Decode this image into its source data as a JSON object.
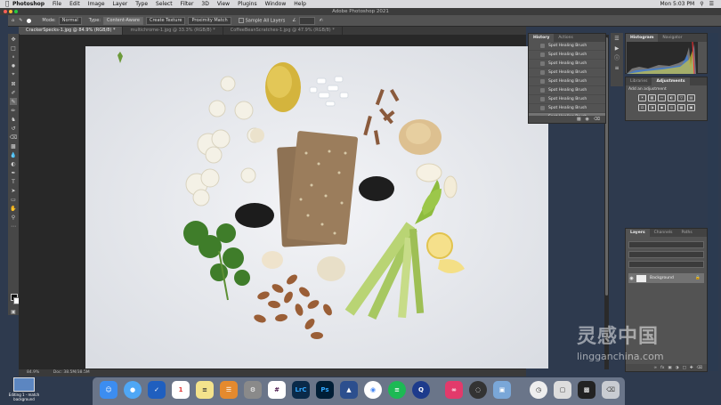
{
  "menubar": {
    "app": "Photoshop",
    "items": [
      "File",
      "Edit",
      "Image",
      "Layer",
      "Type",
      "Select",
      "Filter",
      "3D",
      "View",
      "Plugins",
      "Window",
      "Help"
    ],
    "clock": "Mon 5:03 PM"
  },
  "window": {
    "title": "Adobe Photoshop 2021"
  },
  "options": {
    "mode_label": "Mode:",
    "mode_value": "Normal",
    "type_label": "Type:",
    "type_content_aware": "Content-Aware",
    "type_create_texture": "Create Texture",
    "type_proximity": "Proximity Match",
    "sample_all_layers": "Sample All Layers"
  },
  "tabs": [
    {
      "label": "CrackerSpecks-1.jpg @ 84.9% (RGB/8) *",
      "active": true
    },
    {
      "label": "multichrome-1.jpg @ 33.3% (RGB/8) *",
      "active": false
    },
    {
      "label": "CoffeeBeanScratches-1.jpg @ 47.9% (RGB/8) *",
      "active": false
    }
  ],
  "status": {
    "zoom": "84.9%",
    "doc": "Doc: 38.5M/38.5M"
  },
  "history": {
    "tab_history": "History",
    "tab_actions": "Actions",
    "items": [
      "Spot Healing Brush",
      "Spot Healing Brush",
      "Spot Healing Brush",
      "Spot Healing Brush",
      "Spot Healing Brush",
      "Spot Healing Brush",
      "Spot Healing Brush",
      "Spot Healing Brush",
      "Spot Healing Brush"
    ]
  },
  "right": {
    "histogram_tab": "Histogram",
    "navigator_tab": "Navigator",
    "libraries_tab": "Libraries",
    "adjustments_tab": "Adjustments",
    "add_adjustment": "Add an adjustment",
    "layers_tab": "Layers",
    "channels_tab": "Channels",
    "paths_tab": "Paths",
    "layer_name": "Background"
  },
  "desktop": {
    "item_label": "Editing 1 - match background"
  },
  "dock": [
    "Finder",
    "Messages",
    "Tasks",
    "Calendar",
    "Notes",
    "Books",
    "System Preferences",
    "Slack",
    "LrC",
    "Ps",
    "Affinity",
    "Chrome",
    "Spotify",
    "QuickTime",
    "Creative Cloud",
    "OBS",
    "Preview",
    "Clock",
    "Screenshot",
    "Keynote",
    "Trash"
  ],
  "watermark": {
    "cn": "灵感中国",
    "url": "lingganchina.com"
  },
  "colors": {
    "accent": "#2d6cdf",
    "ps_blue": "#31a8ff",
    "lr_blue": "#0a2a49"
  }
}
